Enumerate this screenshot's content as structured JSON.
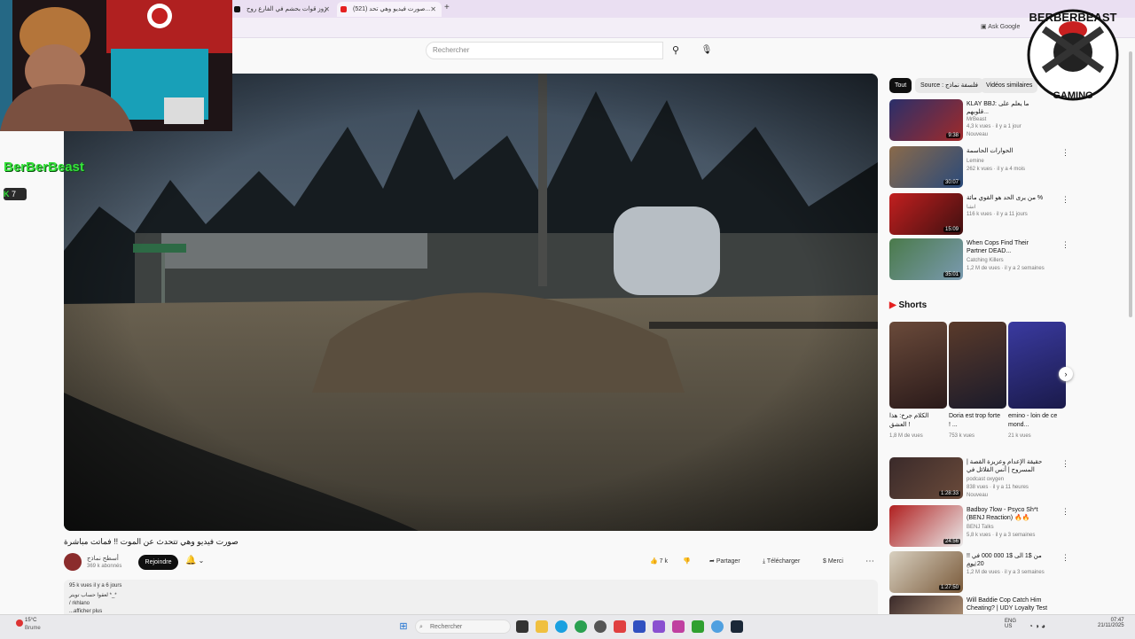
{
  "browser": {
    "tabs": [
      {
        "label": "روز قوات بحشم في الفارع روح",
        "active": false
      },
      {
        "label": "(521) صورت فيديو وهي تحد...",
        "active": true
      }
    ],
    "new_tab": "+",
    "ask_google": "Ask Google"
  },
  "header": {
    "search_placeholder": "Rechercher"
  },
  "video": {
    "title": "صورت فيديو وهي تتحدث عن الموت !! فماتت مباشرة",
    "channel_name": "أسطح نماذج",
    "channel_subs": "369 k abonnés",
    "join_label": "Rejoindre",
    "likes": "7 k",
    "share_label": "Partager",
    "download_label": "Télécharger",
    "thanks_label": "Merci",
    "description": {
      "stats": "95 k vues  il y a 6 jours",
      "line1": "لعقوا حساب تويتر *_*",
      "line2": "/ rkhlano",
      "more": "...afficher plus"
    }
  },
  "sidebar": {
    "chips": [
      "Tout",
      "Source : فلسفة نماذج",
      "Vidéos similaires"
    ],
    "related": [
      {
        "title": "KLAY BBJ: ما يعلم على قلوبهم...",
        "channel": "MrBeast",
        "meta": "4,3 k vues · il y a 1 jour",
        "badge": "Nouveau",
        "duration": "9:38"
      },
      {
        "title": "الحوارات الحاسمة",
        "channel": "Lemine",
        "meta": "262 k vues · il y a 4 mois",
        "duration": "30:07"
      },
      {
        "title": "من يرى الحد هو القوي مائة %",
        "channel": "انشا",
        "meta": "116 k vues · il y a 11 jours",
        "duration": "15:09"
      },
      {
        "title": "When Cops Find Their Partner DEAD...",
        "channel": "Catching Killers",
        "meta": "1,2 M de vues · il y a 2 semaines",
        "duration": "35:01"
      }
    ],
    "shorts_heading": "Shorts",
    "shorts": [
      {
        "title": "الكلام جرخ: هذا العشق !",
        "views": "1,8 M de vues"
      },
      {
        "title": "Doria est trop forte ! ...",
        "views": "753 k vues"
      },
      {
        "title": "emino - loin de ce mond...",
        "views": "21 k vues"
      }
    ],
    "related2": [
      {
        "title": "حقيقة الإعدام وعزيزة القصة | المسروح | أنس القلائل في المغرب",
        "channel": "podcast oxygen",
        "meta": "838 vues · il y a 11 heures",
        "badge": "Nouveau",
        "duration": "1:28:33"
      },
      {
        "title": "Badboy 7low - Psyco Sh*t (BENJ Reaction) 🔥🔥",
        "channel": "BENJ Talks",
        "meta": "5,8 k vues · il y a 3 semaines",
        "duration": "24:56"
      },
      {
        "title": "!! من $1 الى $1 000 000 في 20 يوم",
        "channel": "أنس",
        "meta": "1,2 M de vues · il y a 3 semaines",
        "duration": "1:27:50"
      },
      {
        "title": "Will Baddie Cop Catch Him Cheating? | UDY Loyalty Test",
        "channel": "",
        "meta": "",
        "duration": ""
      }
    ]
  },
  "overlay": {
    "streamer_name": "BerBerBeast",
    "kick_count": "7",
    "badge_top": "BERBERBEAST",
    "badge_bottom": "GAMING"
  },
  "taskbar": {
    "weather_temp": "15°C",
    "weather_text": "Brume",
    "search_label": "Rechercher",
    "lang": "ENG",
    "lang_sub": "US",
    "time": "07:47",
    "date": "21/11/2025"
  }
}
